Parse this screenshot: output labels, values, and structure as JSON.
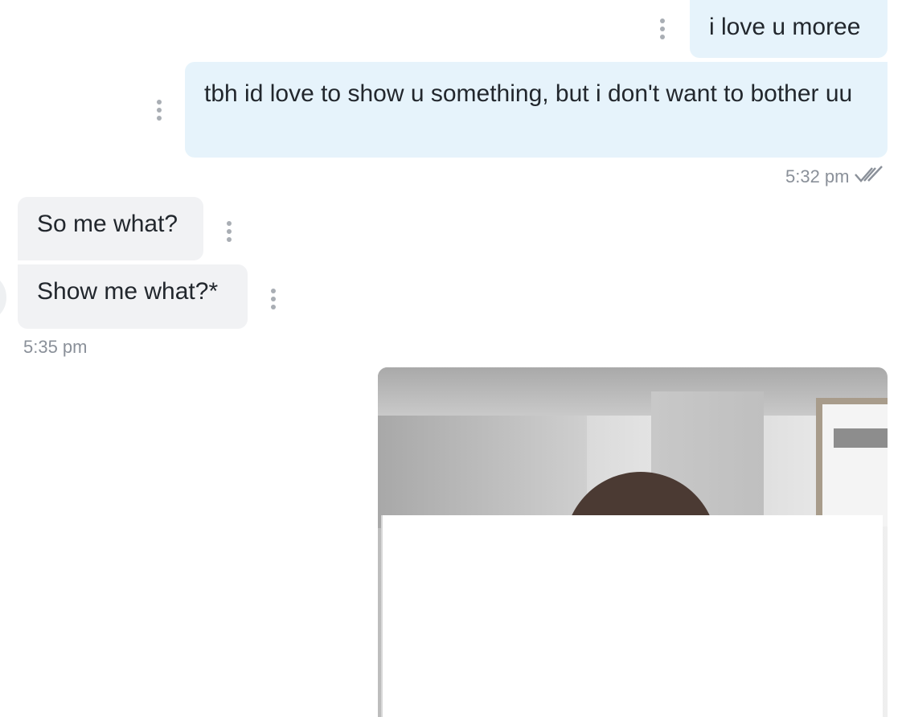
{
  "messages": [
    {
      "id": "m1",
      "direction": "outgoing",
      "text": "i love u moree"
    },
    {
      "id": "m2",
      "direction": "outgoing",
      "text": "tbh id love to show u something, but i don't want to bother uu"
    },
    {
      "id": "m3",
      "direction": "incoming",
      "text": "So me what?"
    },
    {
      "id": "m4",
      "direction": "incoming",
      "text": "Show me what?*"
    }
  ],
  "timestamps": {
    "outgoing_group": "5:32 pm",
    "incoming_group": "5:35 pm"
  },
  "read_receipt": {
    "icon": "double-check-icon",
    "status": "read"
  },
  "colors": {
    "outgoing_bubble": "#e6f3fb",
    "incoming_bubble": "#f1f2f4",
    "timestamp": "#8a9099"
  },
  "attachment": {
    "type": "photo",
    "icon": "image-attachment"
  }
}
